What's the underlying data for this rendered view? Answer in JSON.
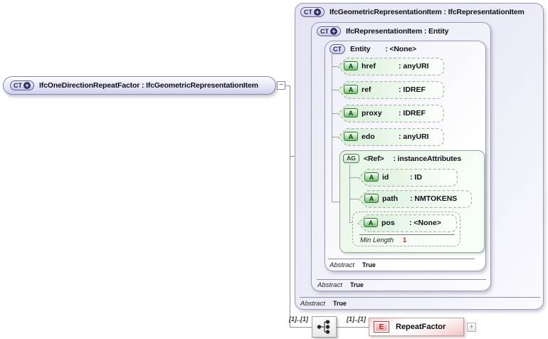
{
  "colors": {
    "lavender_box": "#e9e9f8",
    "green_attr_fill": "#ddf2dd",
    "element_pink": "#f2c6c6",
    "facet_value_red": "#cc2222",
    "connector_gray": "#8f8f9f"
  },
  "icons": {
    "complex_type": "CT",
    "attribute": "A",
    "attribute_group": "AG",
    "element": "E",
    "plus_badge": "+",
    "collapse": "−",
    "expand": "+"
  },
  "main_node": {
    "label": "IfcOneDirectionRepeatFactor : IfcGeometricRepresentationItem"
  },
  "hierarchy": {
    "level1": {
      "title": "IfcGeometricRepresentationItem : IfcRepresentationItem",
      "abstract_label": "Abstract",
      "abstract_value": "True"
    },
    "level2": {
      "title": "IfcRepresentationItem : Entity",
      "abstract_label": "Abstract",
      "abstract_value": "True"
    },
    "level3": {
      "name": "Entity",
      "type": ": <None>",
      "abstract_label": "Abstract",
      "abstract_value": "True",
      "attributes": [
        {
          "name": "href",
          "type": ": anyURI"
        },
        {
          "name": "ref",
          "type": ": IDREF"
        },
        {
          "name": "proxy",
          "type": ": IDREF"
        },
        {
          "name": "edo",
          "type": ": anyURI"
        }
      ],
      "attribute_group": {
        "name": "<Ref>",
        "type": ": instanceAttributes",
        "attributes": [
          {
            "name": "id",
            "type": ": ID"
          },
          {
            "name": "path",
            "type": ": NMTOKENS"
          },
          {
            "name": "pos",
            "type": ": <None>"
          }
        ],
        "facet": {
          "label": "Min Length",
          "value": "1"
        }
      }
    }
  },
  "content_model": {
    "cardinality_before": "[1]..[1]",
    "cardinality_after": "[1]..[1]",
    "element_label": "RepeatFactor"
  }
}
